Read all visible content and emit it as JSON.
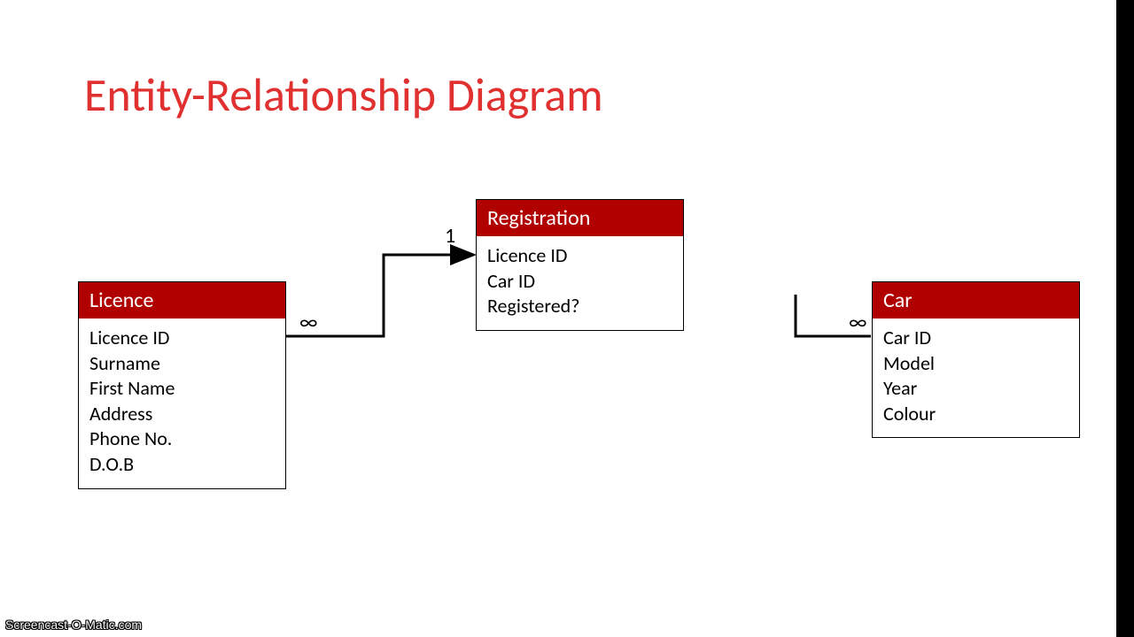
{
  "title": "Entity-Relationship Diagram",
  "entities": {
    "licence": {
      "name": "Licence",
      "attrs": [
        "Licence ID",
        "Surname",
        "First Name",
        "Address",
        "Phone No.",
        "D.O.B"
      ]
    },
    "registration": {
      "name": "Registration",
      "attrs": [
        "Licence ID",
        "Car ID",
        "Registered?"
      ]
    },
    "car": {
      "name": "Car",
      "attrs": [
        "Car ID",
        "Model",
        "Year",
        "Colour"
      ]
    }
  },
  "cardinalities": {
    "licence_side": "∞",
    "registration_side": "1",
    "car_side": "∞"
  },
  "watermark": "Screencast-O-Matic.com"
}
